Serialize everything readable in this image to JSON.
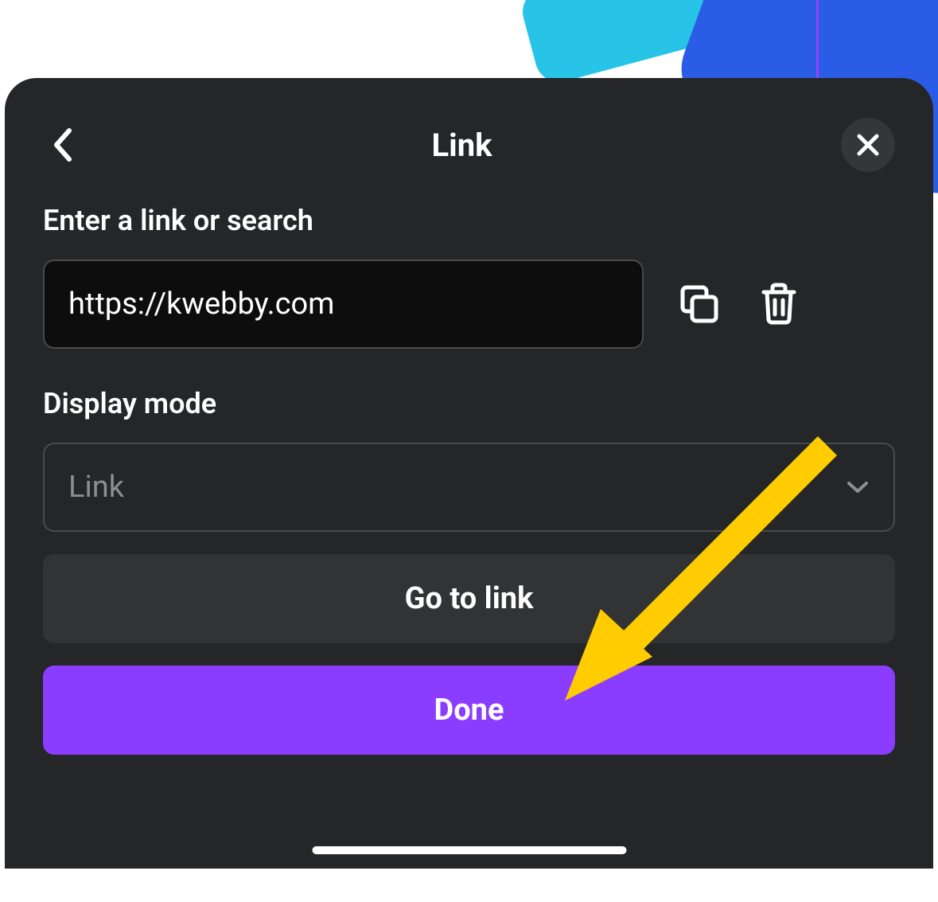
{
  "header": {
    "title": "Link"
  },
  "form": {
    "link_label": "Enter a link or search",
    "link_value": "https://kwebby.com",
    "display_mode_label": "Display mode",
    "display_mode_value": "Link"
  },
  "buttons": {
    "go_to_link": "Go to link",
    "done": "Done"
  },
  "colors": {
    "panel_bg": "#252627",
    "accent": "#8B3DFF",
    "annotation": "#FFCC00"
  }
}
